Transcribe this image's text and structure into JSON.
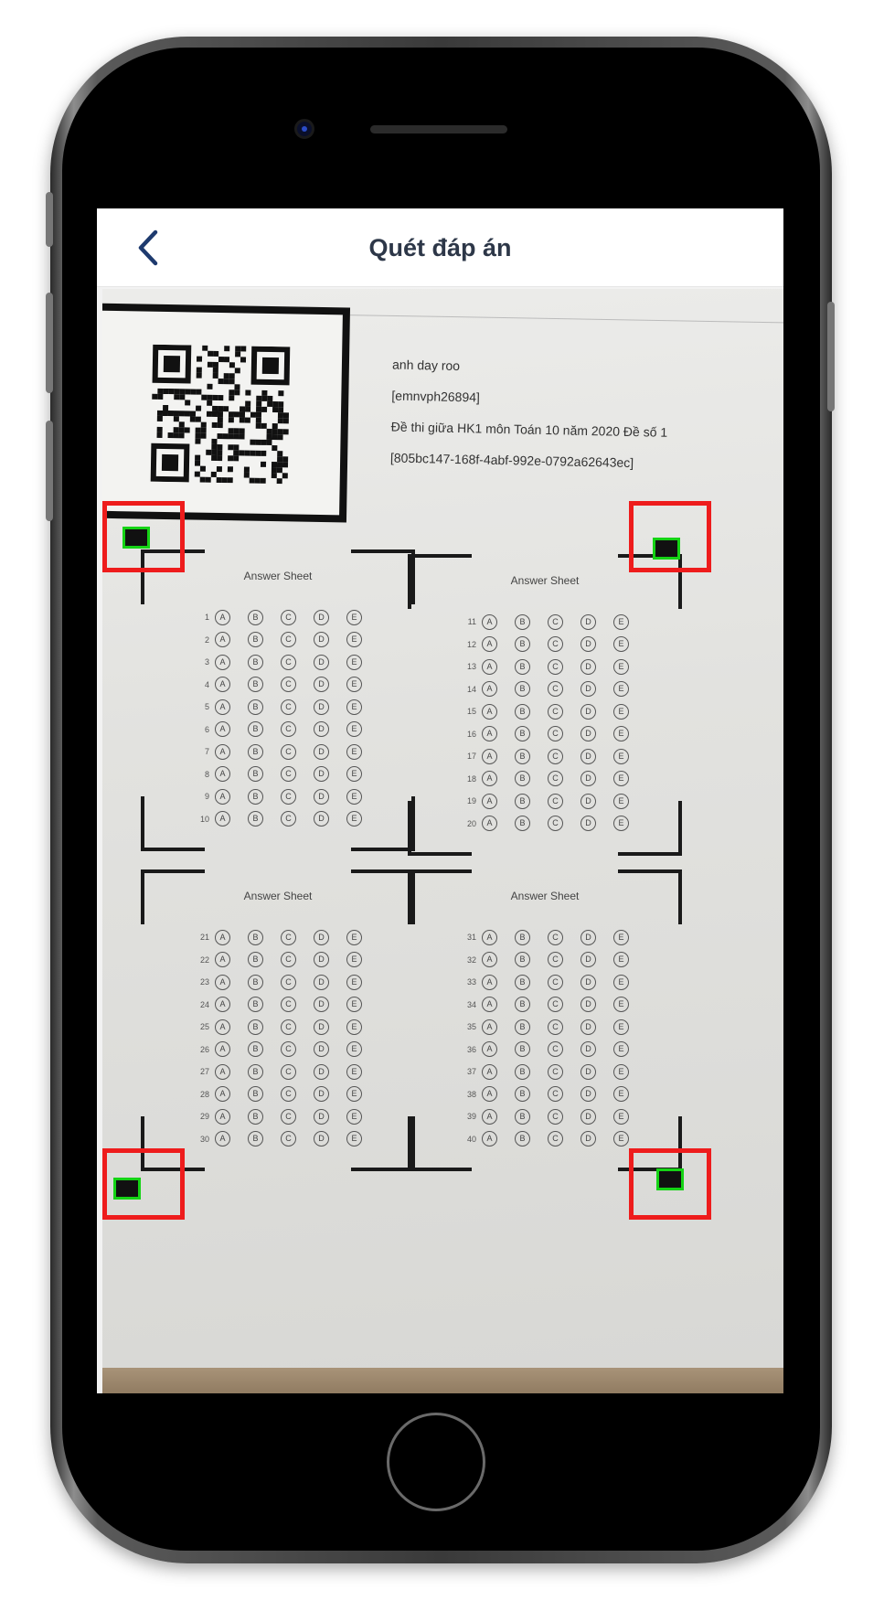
{
  "header": {
    "title": "Quét đáp án",
    "back_icon": "chevron-left-icon"
  },
  "sheet_info": {
    "name": "anh day roo",
    "code": "[emnvph26894]",
    "exam": "Đề thi giữa HK1 môn Toán 10 năm 2020 Đề số 1",
    "exam_id": "[805bc147-168f-4abf-992e-0792a62643ec]"
  },
  "answer_sheets": [
    {
      "title": "Answer Sheet",
      "start": 1,
      "end": 10
    },
    {
      "title": "Answer Sheet",
      "start": 11,
      "end": 20
    },
    {
      "title": "Answer Sheet",
      "start": 21,
      "end": 30
    },
    {
      "title": "Answer Sheet",
      "start": 31,
      "end": 40
    }
  ],
  "options": [
    "A",
    "B",
    "C",
    "D",
    "E"
  ],
  "detection": {
    "marker_color": "#ee1c1c",
    "anchor_color": "#15d315",
    "markers": [
      "top-left",
      "top-right",
      "bottom-left",
      "bottom-right"
    ]
  },
  "colors": {
    "title": "#2d3748",
    "back_arrow": "#1e3a6e"
  }
}
